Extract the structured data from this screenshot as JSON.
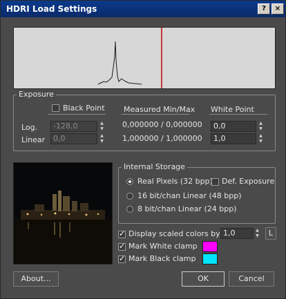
{
  "window": {
    "title": "HDRI Load Settings",
    "help_label": "?",
    "close_label": "×"
  },
  "exposure": {
    "legend": "Exposure",
    "black_point_label": "Black Point",
    "black_point_checked": false,
    "measured_header": "Measured Min/Max",
    "white_point_header": "White Point",
    "log_label": "Log.",
    "linear_label": "Linear",
    "black_log_value": "-128,0",
    "black_linear_value": "0,0",
    "measured_log": "0,000000 / 0,000000",
    "measured_linear": "1,000000 / 1,000000",
    "white_log_value": "0,0",
    "white_linear_value": "1,0"
  },
  "storage": {
    "legend": "Internal Storage",
    "options": [
      {
        "label": "Real Pixels (32 bpp)",
        "selected": true
      },
      {
        "label": "16 bit/chan Linear (48 bpp)",
        "selected": false
      },
      {
        "label": "8 bit/chan Linear (24 bpp)",
        "selected": false
      }
    ],
    "def_exposure_label": "Def. Exposure",
    "def_exposure_checked": false
  },
  "display": {
    "scaled_label": "Display scaled colors by:",
    "scaled_checked": true,
    "scale_value": "1,0",
    "l_button": "L",
    "white_clamp_label": "Mark White clamp",
    "white_clamp_checked": true,
    "white_clamp_color": "#ff00ff",
    "black_clamp_label": "Mark Black clamp",
    "black_clamp_checked": true,
    "black_clamp_color": "#00e5ff"
  },
  "buttons": {
    "about": "About...",
    "ok": "OK",
    "cancel": "Cancel"
  }
}
